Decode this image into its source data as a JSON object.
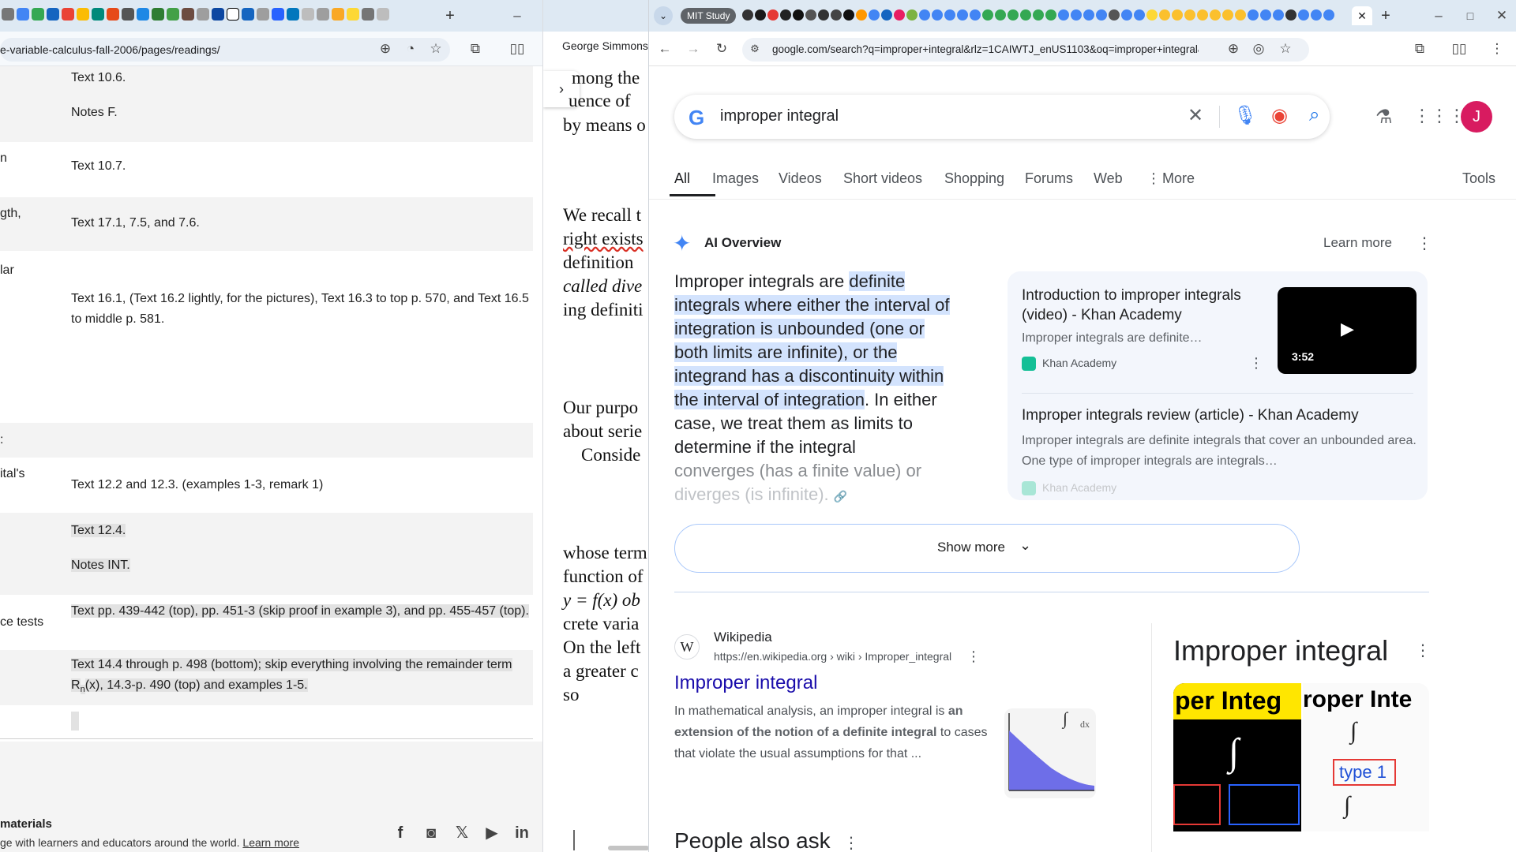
{
  "left": {
    "url": "e-variable-calculus-fall-2006/pages/readings/",
    "rows": [
      {
        "label": "",
        "text": "Text 10.6."
      },
      {
        "label": "",
        "text": "Notes F."
      },
      {
        "label": "n",
        "text": "Text 10.7."
      },
      {
        "label": "gth,",
        "text": "Text 17.1, 7.5, and 7.6."
      },
      {
        "label": "lar",
        "text": ""
      },
      {
        "label": "",
        "text": "Text 16.1, (Text 16.2 lightly, for the pictures), Text 16.3 to top p. 570, and Text 16.5 to middle p. 581."
      },
      {
        "label": "",
        "text": ""
      },
      {
        "label": "ital's",
        "text": "Text 12.2 and 12.3. (examples 1-3, remark 1)"
      },
      {
        "label": "",
        "text": "Text 12.4."
      },
      {
        "label": "",
        "text": "Notes INT."
      },
      {
        "label": "ce tests",
        "text": "Text pp. 439-442 (top), pp. 451-3 (skip proof in example 3), and pp. 455-457 (top)."
      },
      {
        "label": "",
        "text": "Text 14.4 through p. 498 (bottom); skip everything involving the remainder term R"
      },
      {
        "label": "",
        "text": "(x), 14.3-p. 490 (top) and examples 1-5."
      },
      {
        "label": "",
        "text": "n"
      }
    ],
    "footer": {
      "title": " materials",
      "text": "ge with learners and educators around the world.",
      "link": "Learn more"
    }
  },
  "middle": {
    "title": "George Simmons",
    "lines": [
      "mong the",
      "uence of",
      "by means o",
      "We recall t",
      "right exists",
      "definition",
      "called dive",
      "ing definiti",
      "Our purpo",
      "about serie",
      "Conside",
      "whose term",
      "function of",
      "y = f(x) ob",
      "crete varia",
      "On the left",
      "a greater c",
      "so"
    ]
  },
  "right": {
    "tab_group": "MIT Study",
    "url": "google.com/search?q=improper+integral&rlz=1CAIWTJ_enUS1103&oq=improper+integral&gs_lcrp=EgZjaH...",
    "query": "improper integral",
    "nav_tabs": [
      "All",
      "Images",
      "Videos",
      "Short videos",
      "Shopping",
      "Forums",
      "Web",
      "More",
      "Tools"
    ],
    "ai_overview": {
      "title": "AI Overview",
      "learn_more": "Learn more",
      "intro": "Improper integrals are ",
      "highlight": "definite integrals where either the interval of integration is unbounded (one or both limits are infinite), or the integrand has a discontinuity within the interval of integration",
      "rest": ". In either case, we treat them as limits to determine if the integral",
      "faded1": "converges (has a finite value) or",
      "faded2": "diverges (is infinite).",
      "sources": [
        {
          "title": "Introduction to improper integrals (video) - Khan Academy",
          "snippet": "Improper integrals are definite…",
          "site": "Khan Academy",
          "duration": "3:52"
        },
        {
          "title": "Improper integrals review (article) - Khan Academy",
          "snippet": "Improper integrals are definite integrals that cover an unbounded area. One type of improper integrals are integrals…",
          "site": "Khan Academy"
        }
      ],
      "show_more": "Show more"
    },
    "result": {
      "site": "Wikipedia",
      "breadcrumb": "https://en.wikipedia.org › wiki › Improper_integral",
      "title": "Improper integral",
      "snippet_a": "In mathematical analysis, an improper integral is ",
      "snippet_b": "an extension of the notion of a definite integral",
      "snippet_c": " to cases that violate the usual assumptions for that ..."
    },
    "people_also_ask": "People also ask",
    "knowledge": {
      "title": "Improper integral",
      "img1_text": "per Integ",
      "img2_text": "roper Inte",
      "img2_badge": "type 1"
    },
    "avatar": "J",
    "colors": {
      "accent": "#1a0dab",
      "blue": "#1a73e8",
      "avatar": "#d81b60"
    }
  }
}
